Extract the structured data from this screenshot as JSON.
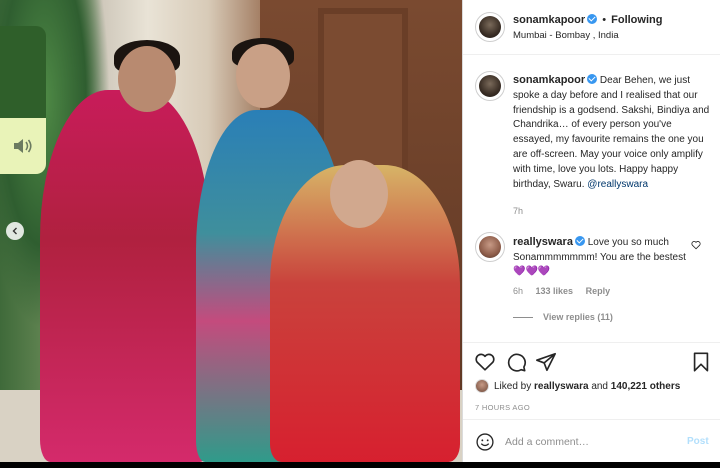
{
  "header": {
    "username": "sonamkapoor",
    "separator": "•",
    "follow_status": "Following",
    "location": "Mumbai - Bombay , India"
  },
  "caption": {
    "username": "sonamkapoor",
    "text": "Dear Behen, we just spoke a day before and I realised that our friendship is a godsend. Sakshi, Bindiya and Chandrika… of every person you've essayed, my favourite remains the one you are off-screen. May your voice only amplify with time, love you lots. Happy happy birthday, Swaru. ",
    "mention": "@reallyswara",
    "time": "7h"
  },
  "comment": {
    "username": "reallyswara",
    "text": "Love you so much Sonammmmmmm! You are the bestest ",
    "hearts": "💜💜💜",
    "time": "6h",
    "likes": "133 likes",
    "reply_label": "Reply",
    "view_replies": "View replies (11)"
  },
  "actions": {
    "liked_by_prefix": "Liked by ",
    "liked_by_user": "reallyswara",
    "liked_by_and": " and ",
    "liked_by_count": "140,221 others",
    "timestamp": "7 HOURS AGO"
  },
  "add_comment": {
    "placeholder": "Add a comment…",
    "post_label": "Post"
  },
  "colors": {
    "verified": "#3897f0",
    "post_disabled": "#b2dffc",
    "mention": "#00376b"
  }
}
